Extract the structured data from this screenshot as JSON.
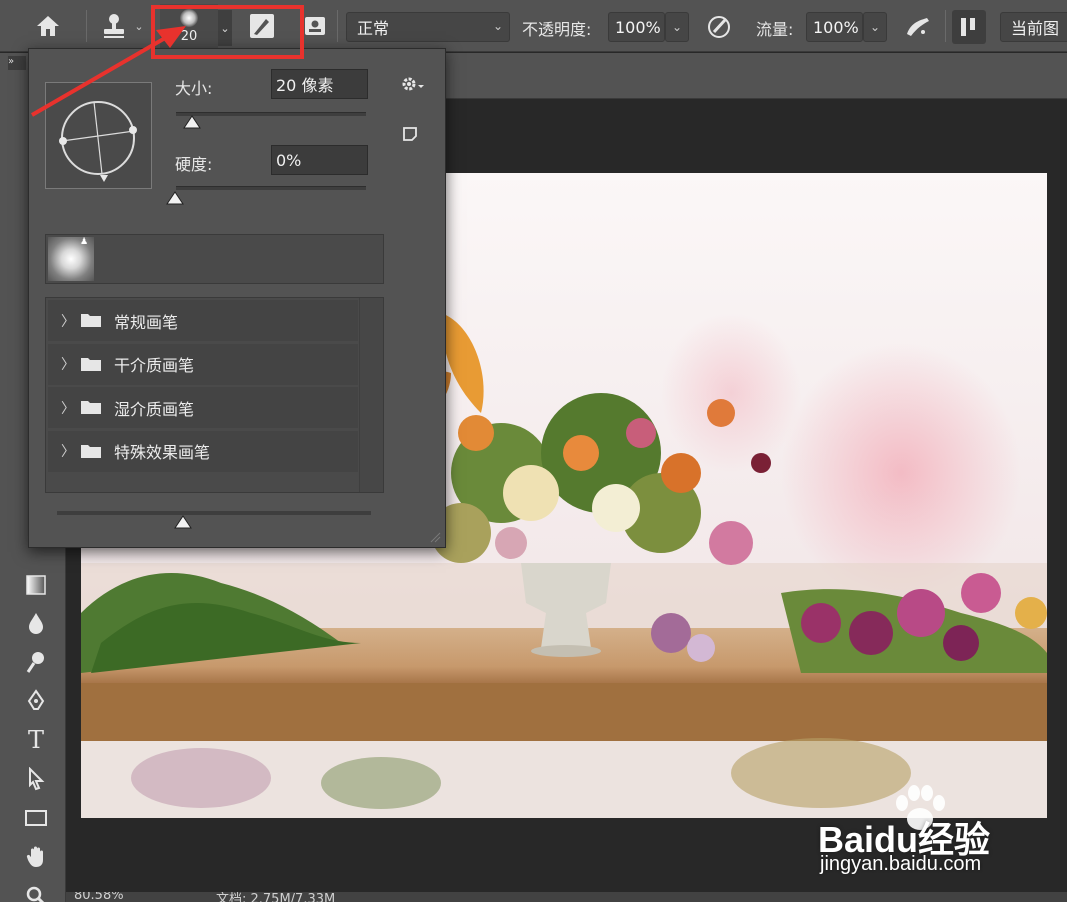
{
  "options_bar": {
    "brush_size": "20",
    "mode_label": "正常",
    "opacity_label": "不透明度:",
    "opacity_value": "100%",
    "flow_label": "流量:",
    "flow_value": "100%",
    "sample_label": "当前图"
  },
  "brush_panel": {
    "size_label": "大小:",
    "size_value": "20 像素",
    "size_fraction": 0.04,
    "hardness_label": "硬度:",
    "hardness_value": "0%",
    "hardness_fraction": 0.0,
    "bottom_slider_fraction": 0.4,
    "groups": [
      {
        "label": "常规画笔"
      },
      {
        "label": "干介质画笔"
      },
      {
        "label": "湿介质画笔"
      },
      {
        "label": "特殊效果画笔"
      }
    ]
  },
  "status_bar": {
    "zoom": "80.58%",
    "doc_info": "文档: 2.75M/7.33M"
  },
  "watermark": {
    "brand": "Baidu经验",
    "url": "jingyan.baidu.com"
  },
  "colors": {
    "highlight": "#e8322d",
    "panel_bg": "#535353",
    "workspace_bg": "#282828"
  }
}
